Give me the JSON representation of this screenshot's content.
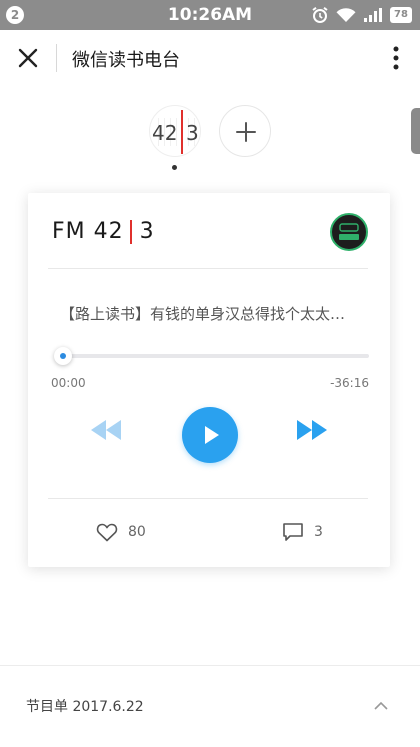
{
  "status_bar": {
    "notification_count": "2",
    "time": "10:26AM",
    "battery": "78",
    "icons": [
      "alarm-icon",
      "wifi-icon",
      "signal-icon",
      "battery-icon"
    ]
  },
  "title_bar": {
    "title": "微信读书电台",
    "close_icon": "close-icon",
    "more_icon": "more-vertical-icon"
  },
  "station_selector": {
    "left_num": "42",
    "right_num": "3",
    "add_icon": "plus-icon"
  },
  "player": {
    "fm_prefix": "FM 42",
    "fm_suffix": "3",
    "program_title": "【路上读书】有钱的单身汉总得找个太太…",
    "elapsed": "00:00",
    "remaining": "-36:16",
    "progress": 0.0,
    "likes": "80",
    "comments": "3"
  },
  "bottom": {
    "schedule": "节目单 2017.6.22"
  },
  "colors": {
    "accent_blue": "#2aa1ef",
    "accent_red": "#e0302c",
    "status_bar": "#8c8c8c"
  }
}
